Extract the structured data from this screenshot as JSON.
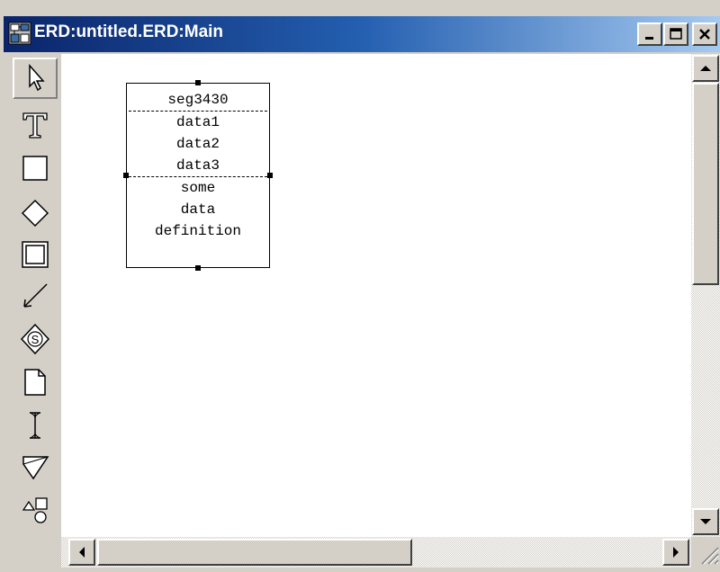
{
  "window": {
    "title": "ERD:untitled.ERD:Main",
    "buttons": {
      "minimize": "_",
      "maximize": "□",
      "close": "X"
    }
  },
  "toolbar": {
    "tools": [
      {
        "name": "pointer-tool",
        "icon": "arrow-pointer-icon",
        "selected": true
      },
      {
        "name": "text-tool",
        "icon": "text-T-icon"
      },
      {
        "name": "entity-tool",
        "icon": "rectangle-icon"
      },
      {
        "name": "relationship-tool",
        "icon": "diamond-icon"
      },
      {
        "name": "weak-entity-tool",
        "icon": "double-rectangle-icon"
      },
      {
        "name": "connector-tool",
        "icon": "line-arrow-icon"
      },
      {
        "name": "subtype-tool",
        "icon": "diamond-s-icon"
      },
      {
        "name": "note-tool",
        "icon": "document-icon"
      },
      {
        "name": "cardinality-tool",
        "icon": "i-beam-icon"
      },
      {
        "name": "triangle-tool",
        "icon": "triangle-icon"
      },
      {
        "name": "shapes-tool",
        "icon": "shapes-icon"
      }
    ]
  },
  "entity": {
    "name": "seg3430",
    "attributes": [
      "data1",
      "data2",
      "data3"
    ],
    "definition": [
      "some",
      "data",
      "definition"
    ]
  },
  "colors": {
    "titlebar_start": "#0a246a",
    "titlebar_end": "#a6caf0",
    "chrome": "#d4d0c8"
  }
}
